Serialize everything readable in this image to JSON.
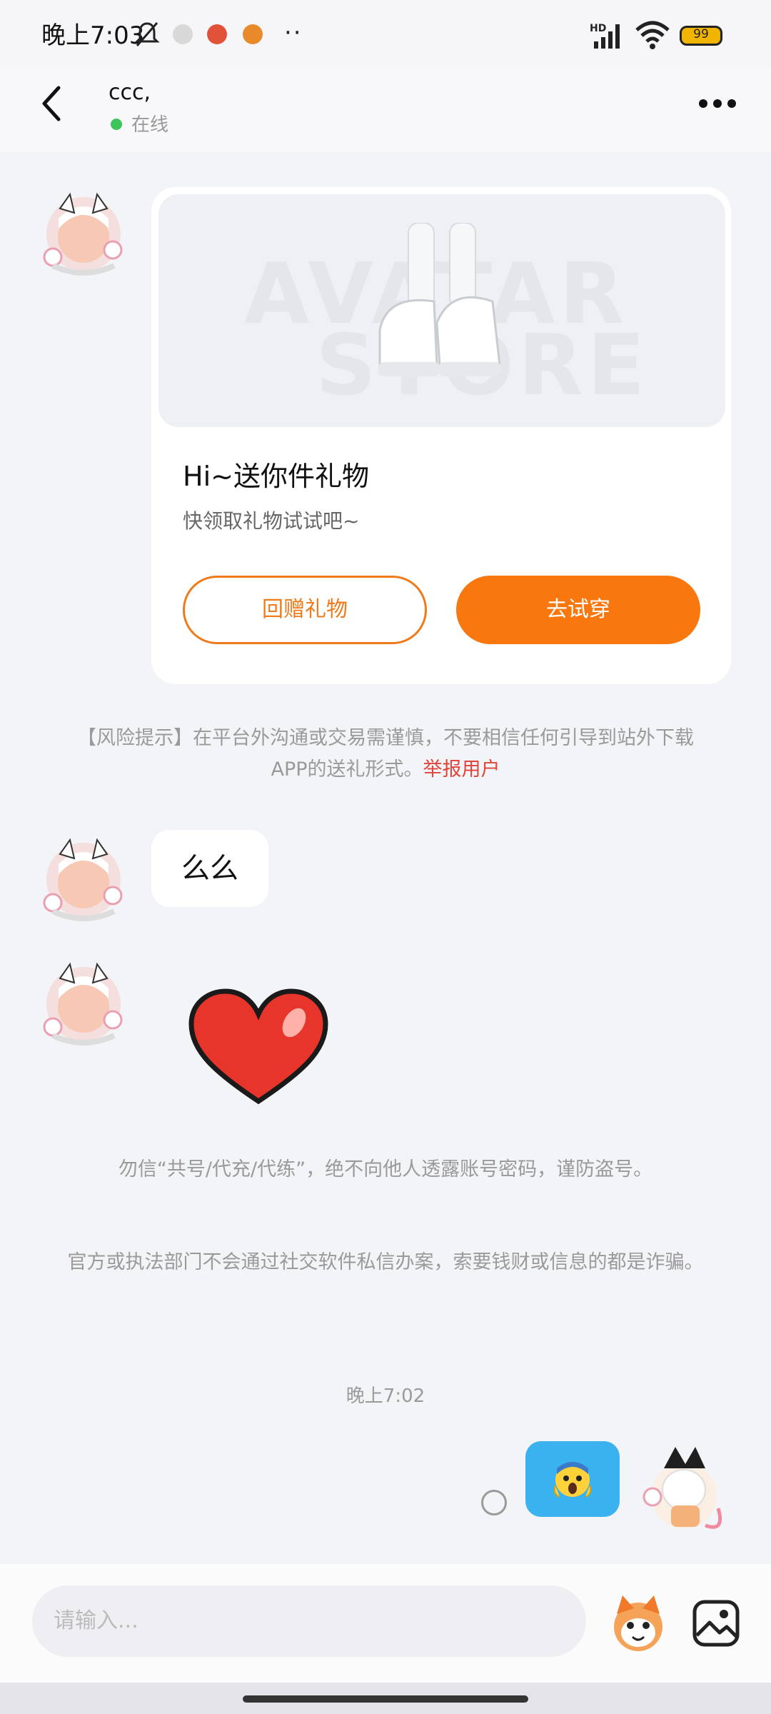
{
  "status_bar": {
    "time": "晚上7:03",
    "battery": "99"
  },
  "header": {
    "contact_name": "ccc,",
    "status": "在线"
  },
  "gift_card": {
    "title": "Hi~送你件礼物",
    "subtitle": "快领取礼物试试吧~",
    "return_gift_label": "回赠礼物",
    "try_on_label": "去试穿",
    "watermark_line1": "AVATAR",
    "watermark_line2": "STORE"
  },
  "risk_notice": {
    "text": "【风险提示】在平台外沟通或交易需谨慎，不要相信任何引导到站外下载APP的送礼形式。",
    "report_link": "举报用户"
  },
  "messages": {
    "received_text": "么么"
  },
  "warnings": {
    "line1": "勿信“共号/代充/代练”，绝不向他人透露账号密码，谨防盗号。",
    "line2": "官方或执法部门不会通过社交软件私信办案，索要钱财或信息的都是诈骗。"
  },
  "timestamp": "晚上7:02",
  "input": {
    "placeholder": "请输入..."
  },
  "colors": {
    "accent": "#f8780f",
    "sent_bubble": "#3ab2f0",
    "report": "#e0443a",
    "online": "#3cc55a"
  }
}
